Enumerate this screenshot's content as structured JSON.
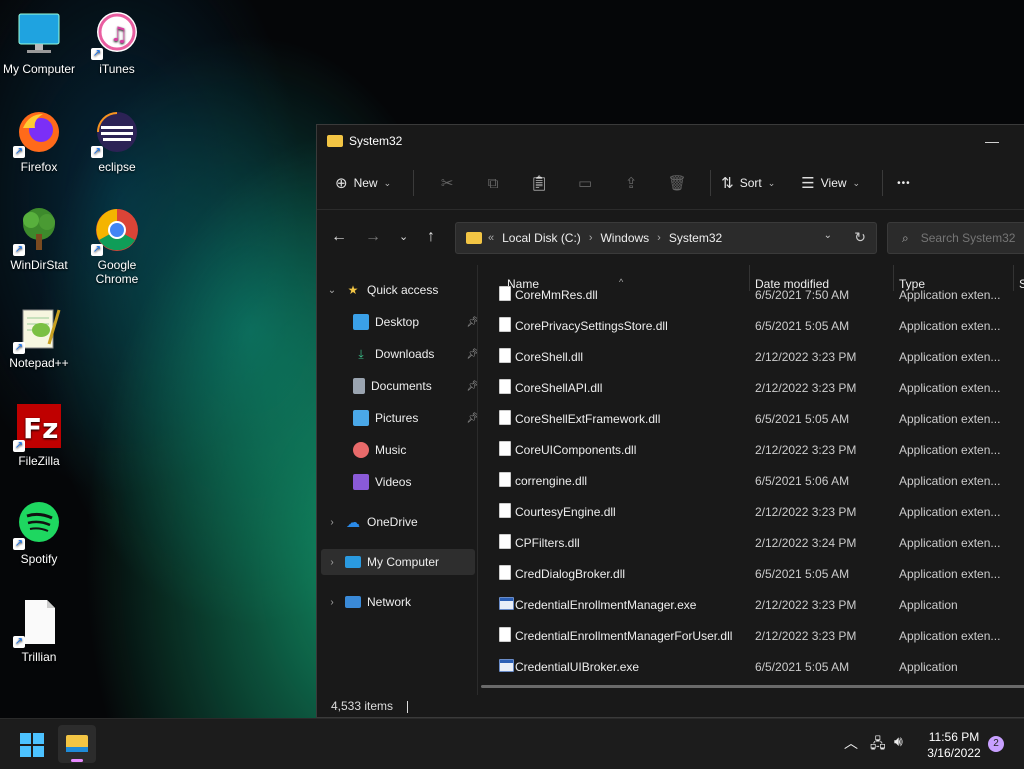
{
  "desktop": {
    "icons": [
      {
        "label": "My Computer",
        "icon": "monitor-icon"
      },
      {
        "label": "iTunes",
        "icon": "itunes-icon"
      },
      {
        "label": "Firefox",
        "icon": "firefox-icon"
      },
      {
        "label": "eclipse",
        "icon": "eclipse-icon"
      },
      {
        "label": "WinDirStat",
        "icon": "windirstat-icon"
      },
      {
        "label": "Google Chrome",
        "icon": "chrome-icon"
      },
      {
        "label": "Notepad++",
        "icon": "notepadpp-icon"
      },
      {
        "label": "FileZilla",
        "icon": "filezilla-icon"
      },
      {
        "label": "Spotify",
        "icon": "spotify-icon"
      },
      {
        "label": "Trillian",
        "icon": "trillian-icon"
      }
    ]
  },
  "window": {
    "title": "System32",
    "minimize_glyph": "—"
  },
  "toolbar": {
    "new_label": "New",
    "sort_label": "Sort",
    "view_label": "View",
    "more_glyph": "•••"
  },
  "address": {
    "prefix": "«",
    "crumbs": [
      "Local Disk (C:)",
      "Windows",
      "System32"
    ],
    "search_placeholder": "Search System32"
  },
  "sidebar": {
    "quick_access": "Quick access",
    "items": [
      {
        "label": "Desktop",
        "pinned": true
      },
      {
        "label": "Downloads",
        "pinned": true
      },
      {
        "label": "Documents",
        "pinned": true
      },
      {
        "label": "Pictures",
        "pinned": true
      },
      {
        "label": "Music",
        "pinned": false
      },
      {
        "label": "Videos",
        "pinned": false
      }
    ],
    "onedrive": "OneDrive",
    "my_computer": "My Computer",
    "network": "Network"
  },
  "columns": {
    "name": "Name",
    "date": "Date modified",
    "type": "Type",
    "size": "S"
  },
  "files": [
    {
      "name": "CoreMmRes.dll",
      "date": "6/5/2021 7:50 AM",
      "type": "Application exten...",
      "kind": "dll"
    },
    {
      "name": "CorePrivacySettingsStore.dll",
      "date": "6/5/2021 5:05 AM",
      "type": "Application exten...",
      "kind": "dll"
    },
    {
      "name": "CoreShell.dll",
      "date": "2/12/2022 3:23 PM",
      "type": "Application exten...",
      "kind": "dll"
    },
    {
      "name": "CoreShellAPI.dll",
      "date": "2/12/2022 3:23 PM",
      "type": "Application exten...",
      "kind": "dll"
    },
    {
      "name": "CoreShellExtFramework.dll",
      "date": "6/5/2021 5:05 AM",
      "type": "Application exten...",
      "kind": "dll"
    },
    {
      "name": "CoreUIComponents.dll",
      "date": "2/12/2022 3:23 PM",
      "type": "Application exten...",
      "kind": "dll"
    },
    {
      "name": "correngine.dll",
      "date": "6/5/2021 5:06 AM",
      "type": "Application exten...",
      "kind": "dll"
    },
    {
      "name": "CourtesyEngine.dll",
      "date": "2/12/2022 3:23 PM",
      "type": "Application exten...",
      "kind": "dll"
    },
    {
      "name": "CPFilters.dll",
      "date": "2/12/2022 3:24 PM",
      "type": "Application exten...",
      "kind": "dll"
    },
    {
      "name": "CredDialogBroker.dll",
      "date": "6/5/2021 5:05 AM",
      "type": "Application exten...",
      "kind": "dll"
    },
    {
      "name": "CredentialEnrollmentManager.exe",
      "date": "2/12/2022 3:23 PM",
      "type": "Application",
      "kind": "exe"
    },
    {
      "name": "CredentialEnrollmentManagerForUser.dll",
      "date": "2/12/2022 3:23 PM",
      "type": "Application exten...",
      "kind": "dll"
    },
    {
      "name": "CredentialUIBroker.exe",
      "date": "6/5/2021 5:05 AM",
      "type": "Application",
      "kind": "exe"
    }
  ],
  "status": {
    "items": "4,533 items"
  },
  "taskbar": {
    "time": "11:56 PM",
    "date": "3/16/2022",
    "notifications": "2"
  }
}
